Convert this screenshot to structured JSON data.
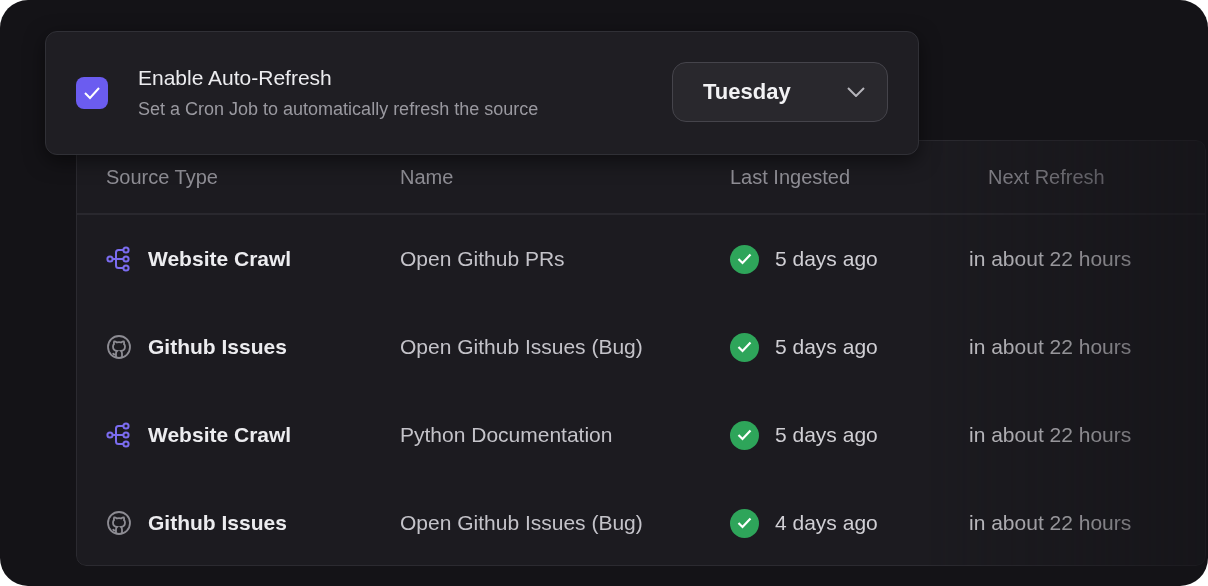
{
  "auto_refresh": {
    "checked": true,
    "title": "Enable Auto-Refresh",
    "description": "Set a Cron Job to automatically refresh the source",
    "day": "Tuesday"
  },
  "table": {
    "columns": [
      "Source Type",
      "Name",
      "Last Ingested",
      "Next Refresh"
    ],
    "rows": [
      {
        "kind": "website",
        "source_type": "Website Crawl",
        "name": "Open Github PRs",
        "last_ingested": "5 days ago",
        "next_refresh": "in about 22 hours"
      },
      {
        "kind": "github",
        "source_type": "Github Issues",
        "name": "Open Github Issues (Bug)",
        "last_ingested": "5 days ago",
        "next_refresh": "in about 22 hours"
      },
      {
        "kind": "website",
        "source_type": "Website Crawl",
        "name": "Python Documentation",
        "last_ingested": "5 days ago",
        "next_refresh": "in about 22 hours"
      },
      {
        "kind": "github",
        "source_type": "Github Issues",
        "name": "Open Github Issues (Bug)",
        "last_ingested": "4 days ago",
        "next_refresh": "in about 22 hours"
      }
    ]
  }
}
